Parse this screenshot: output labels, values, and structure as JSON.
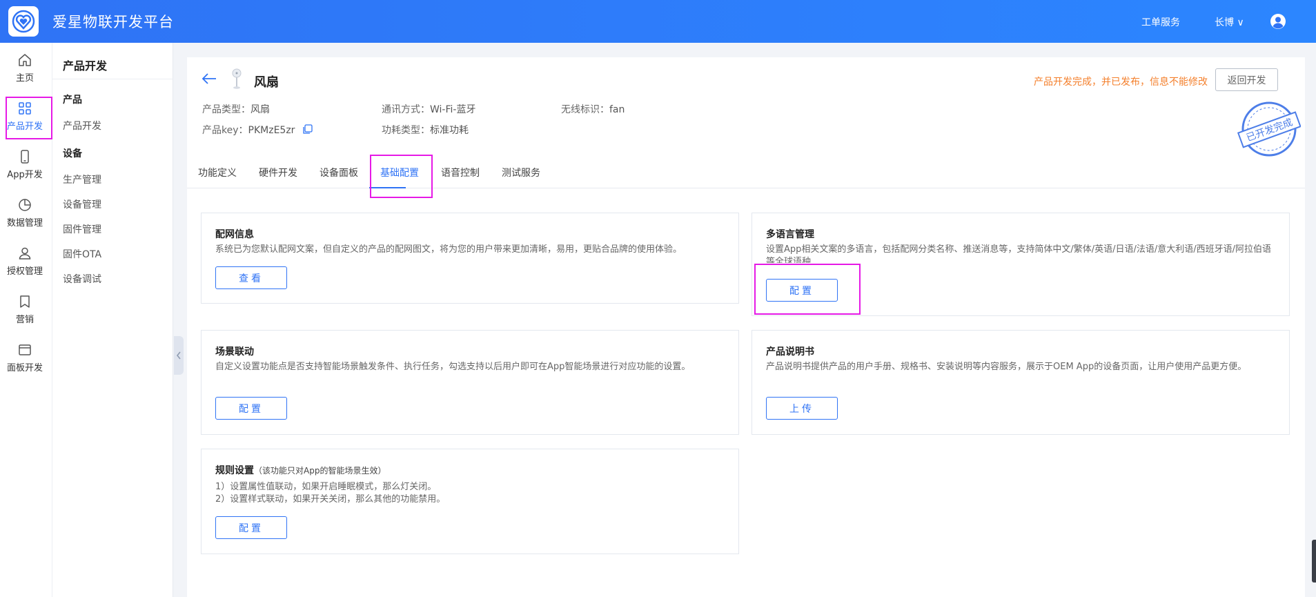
{
  "app": {
    "brand": "爱星物联开发平台"
  },
  "header": {
    "service": "工单服务",
    "user": "长博 ∨"
  },
  "rail": {
    "items": [
      {
        "label": "主页",
        "icon": "home-icon"
      },
      {
        "label": "产品开发",
        "icon": "grid-icon",
        "active": true
      },
      {
        "label": "App开发",
        "icon": "phone-icon"
      },
      {
        "label": "数据管理",
        "icon": "pie-chart-icon"
      },
      {
        "label": "授权管理",
        "icon": "user-icon"
      },
      {
        "label": "营销",
        "icon": "bookmark-icon"
      },
      {
        "label": "面板开发",
        "icon": "panel-icon"
      }
    ]
  },
  "subnav": {
    "title": "产品开发",
    "groups": [
      {
        "label": "产品",
        "items": [
          "产品开发"
        ]
      },
      {
        "label": "设备",
        "items": [
          "生产管理",
          "设备管理",
          "固件管理",
          "固件OTA",
          "设备调试"
        ]
      }
    ]
  },
  "product": {
    "name": "风扇",
    "type_label": "产品类型：",
    "type_value": "风扇",
    "comm_label": "通讯方式：",
    "comm_value": "Wi-Fi-蓝牙",
    "wireless_label": "无线标识：",
    "wireless_value": "fan",
    "key_label": "产品key：",
    "key_value": "PKMzE5zr",
    "power_label": "功耗类型：",
    "power_value": "标准功耗",
    "notice": "产品开发完成，并已发布，信息不能修改",
    "return_btn": "返回开发",
    "stamp": "已开发完成"
  },
  "tabs": [
    "功能定义",
    "硬件开发",
    "设备面板",
    "基础配置",
    "语音控制",
    "测试服务"
  ],
  "active_tab": "基础配置",
  "cards": {
    "network": {
      "title": "配网信息",
      "desc": "系统已为您默认配网文案，但自定义的产品的配网图文，将为您的用户带来更加清晰，易用，更贴合品牌的使用体验。",
      "button": "查看"
    },
    "language": {
      "title": "多语言管理",
      "desc": "设置App相关文案的多语言，包括配网分类名称、推送消息等，支持简体中文/繁体/英语/日语/法语/意大利语/西班牙语/阿拉伯语等全球语种",
      "button": "配置"
    },
    "scene": {
      "title": "场景联动",
      "desc": "自定义设置功能点是否支持智能场景触发条件、执行任务，勾选支持以后用户即可在App智能场景进行对应功能的设置。",
      "button": "配置"
    },
    "manual": {
      "title": "产品说明书",
      "desc": "产品说明书提供产品的用户手册、规格书、安装说明等内容服务，展示于OEM App的设备页面，让用户使用产品更方便。",
      "button": "上传"
    },
    "rules": {
      "title": "规则设置",
      "note": "（该功能只对App的智能场景生效）",
      "line1": "1）设置属性值联动，如果开启睡眠模式，那么灯关闭。",
      "line2": "2）设置样式联动，如果开关关闭，那么其他的功能禁用。",
      "button": "配置"
    }
  },
  "colors": {
    "primary": "#2f73f5",
    "highlight": "#e619e6",
    "notice": "#f47f2b"
  }
}
